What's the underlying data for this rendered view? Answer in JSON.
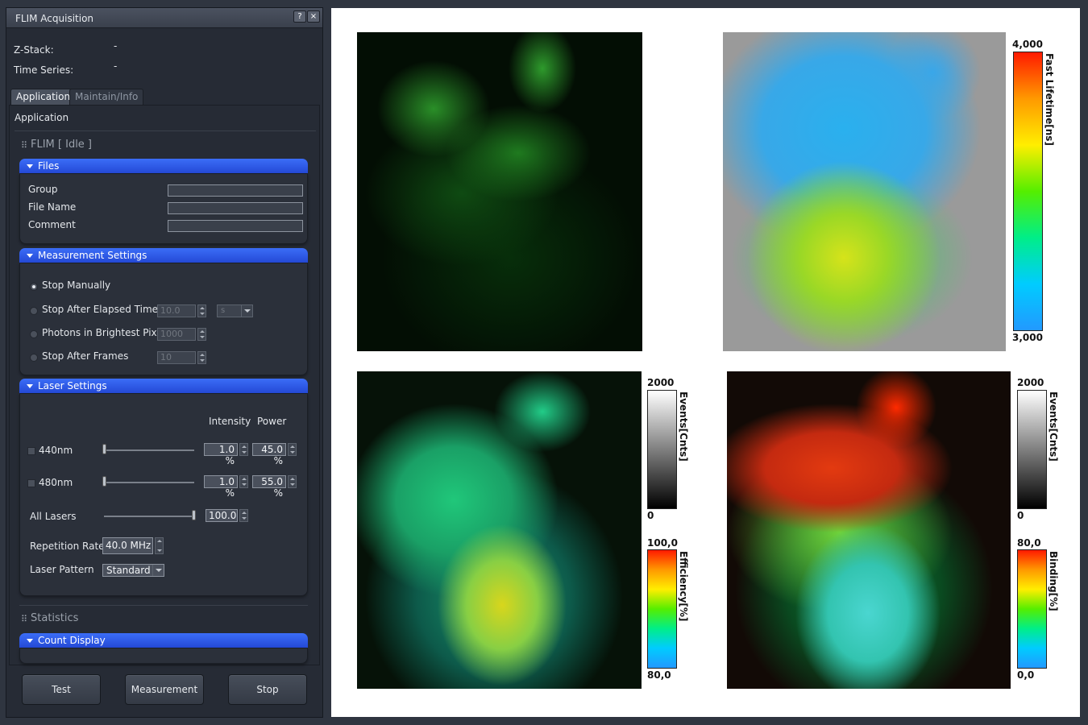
{
  "window": {
    "title": "FLIM Acquisition",
    "help_label": "?",
    "close_label": "×"
  },
  "info": {
    "zstack_label": "Z-Stack:",
    "zstack_value": "-",
    "timeseries_label": "Time Series:",
    "timeseries_value": "-"
  },
  "tabs": [
    {
      "label": "Application",
      "active": true
    },
    {
      "label": "Maintain/Info",
      "active": false
    }
  ],
  "section_title": "Application",
  "flim_header": "FLIM [ Idle ]",
  "files": {
    "title": "Files",
    "group_label": "Group",
    "group_value": "",
    "filename_label": "File Name",
    "filename_value": "",
    "comment_label": "Comment",
    "comment_value": ""
  },
  "measurement": {
    "title": "Measurement Settings",
    "options": [
      {
        "label": "Stop Manually",
        "selected": true
      },
      {
        "label": "Stop After Elapsed Time",
        "value": "10.0",
        "unit": "s"
      },
      {
        "label": "Photons in Brightest Pixel",
        "value": "1000"
      },
      {
        "label": "Stop After Frames",
        "value": "10"
      }
    ]
  },
  "laser": {
    "title": "Laser Settings",
    "intensity_header": "Intensity",
    "power_header": "Power",
    "lines": [
      {
        "label": "440nm",
        "intensity": "1.0 %",
        "power": "45.0 %",
        "checked": false
      },
      {
        "label": "480nm",
        "intensity": "1.0 %",
        "power": "55.0 %",
        "checked": false
      }
    ],
    "all_lasers_label": "All Lasers",
    "all_lasers_value": "100.0 %",
    "repetition_label": "Repetition Rate",
    "repetition_value": "40.0 MHz",
    "pattern_label": "Laser Pattern",
    "pattern_value": "Standard"
  },
  "statistics_header": "Statistics",
  "count_display": {
    "title": "Count Display"
  },
  "buttons": {
    "test": "Test",
    "measurement": "Measurement",
    "stop": "Stop"
  },
  "colorbars": {
    "lifetime": {
      "title": "Fast Lifetime[ns]",
      "max": "4,000",
      "min": "3,000"
    },
    "events_left": {
      "title": "Events[Cnts]",
      "max": "2000",
      "min": "0"
    },
    "efficiency": {
      "title": "Efficiency[%]",
      "max": "100,0",
      "min": "80,0"
    },
    "events_right": {
      "title": "Events[Cnts]",
      "max": "2000",
      "min": "0"
    },
    "binding": {
      "title": "Binding[%]",
      "max": "80,0",
      "min": "0,0"
    }
  },
  "colors": {
    "accent_header": "#2f5ef0",
    "panel_bg": "#262b35",
    "lifetime_gradient": [
      "#ff1a00",
      "#ff9900",
      "#ffee00",
      "#55ee00",
      "#00ee88",
      "#00ccff",
      "#2299ff"
    ]
  }
}
